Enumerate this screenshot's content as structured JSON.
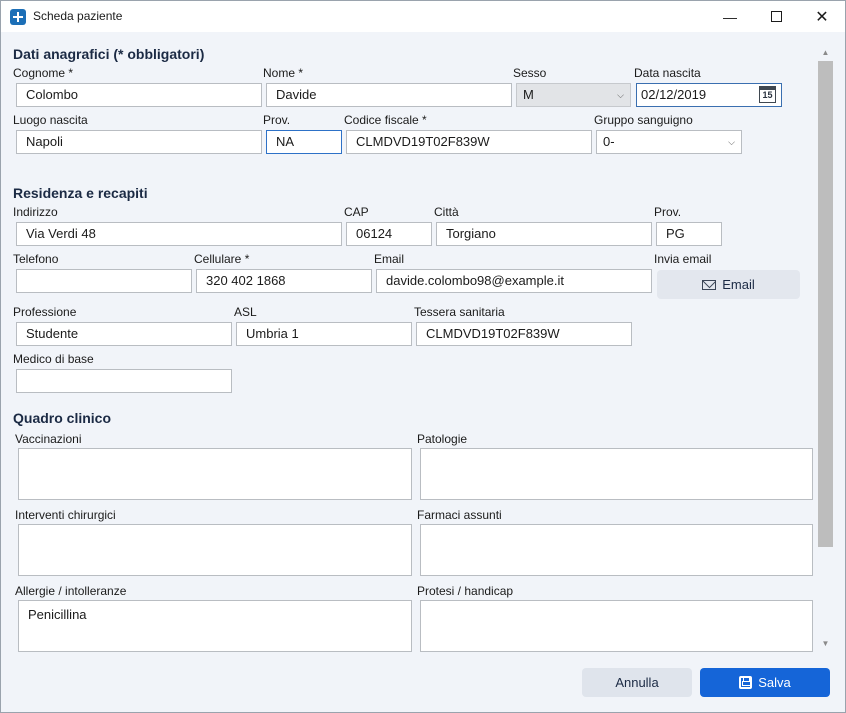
{
  "window": {
    "title": "Scheda paziente"
  },
  "sections": {
    "anagrafica": "Dati anagrafici (* obbligatori)",
    "residenza": "Residenza e recapiti",
    "clinico": "Quadro clinico"
  },
  "labels": {
    "cognome": "Cognome *",
    "nome": "Nome *",
    "sesso": "Sesso",
    "data_nascita": "Data nascita",
    "luogo_nascita": "Luogo nascita",
    "prov_nascita": "Prov.",
    "codice_fiscale": "Codice fiscale *",
    "gruppo_sanguigno": "Gruppo sanguigno",
    "indirizzo": "Indirizzo",
    "cap": "CAP",
    "citta": "Città",
    "prov_residenza": "Prov.",
    "telefono": "Telefono",
    "cellulare": "Cellulare *",
    "email": "Email",
    "invia_email": "Invia email",
    "professione": "Professione",
    "asl": "ASL",
    "tessera": "Tessera sanitaria",
    "medico": "Medico di base",
    "vaccinazioni": "Vaccinazioni",
    "patologie": "Patologie",
    "interventi": "Interventi chirurgici",
    "farmaci": "Farmaci assunti",
    "allergie": "Allergie / intolleranze",
    "protesi": "Protesi / handicap"
  },
  "values": {
    "cognome": "Colombo",
    "nome": "Davide",
    "sesso": "M",
    "data_nascita": "02/12/2019",
    "luogo_nascita": "Napoli",
    "prov_nascita": "NA",
    "codice_fiscale": "CLMDVD19T02F839W",
    "gruppo_sanguigno": "0-",
    "indirizzo": "Via Verdi 48",
    "cap": "06124",
    "citta": "Torgiano",
    "prov_residenza": "PG",
    "telefono": "",
    "cellulare": "320 402 1868",
    "email": "davide.colombo98@example.it",
    "professione": "Studente",
    "asl": "Umbria 1",
    "tessera": "CLMDVD19T02F839W",
    "medico": "",
    "vaccinazioni": "",
    "patologie": "",
    "interventi": "",
    "farmaci": "",
    "allergie": "Penicillina",
    "protesi": ""
  },
  "calendar_day": "15",
  "buttons": {
    "email": "Email",
    "cancel": "Annulla",
    "save": "Salva"
  },
  "icons": {
    "app": "medical-cross-icon",
    "minimize": "minimize-icon",
    "maximize": "maximize-icon",
    "close": "close-icon",
    "calendar": "calendar-icon",
    "dropdown": "chevron-down-icon",
    "email": "envelope-icon",
    "save": "floppy-disk-icon"
  },
  "colors": {
    "accent": "#1565d8",
    "section_title": "#1b2a44",
    "background": "#f1f4f9"
  }
}
